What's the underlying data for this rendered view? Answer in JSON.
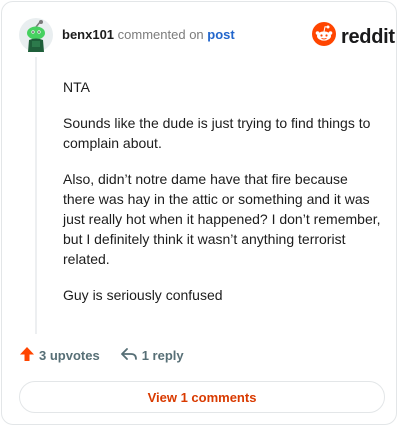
{
  "header": {
    "username": "benx101",
    "action_text": "commented on",
    "post_link": "post",
    "brand": "reddit",
    "avatar_icon": "snoo-avatar-icon",
    "brand_icon": "reddit-logo-icon"
  },
  "comment": {
    "paragraphs": [
      "NTA",
      "Sounds like the dude is just trying to find things to complain about.",
      "Also, didn’t notre dame have that fire because there was hay in the attic or something and it was just really hot when it happened? I don’t remember, but I definitely think it wasn’t anything terrorist related.",
      "Guy is seriously confused"
    ]
  },
  "actions": {
    "upvotes_label": "3 upvotes",
    "reply_label": "1 reply",
    "upvote_icon": "upvote-arrow-icon",
    "reply_icon": "reply-arrow-icon"
  },
  "footer": {
    "view_comments_label": "View 1 comments"
  },
  "colors": {
    "brand_orange": "#ff4500",
    "view_button_text": "#d93a00",
    "link_blue": "#2266cc"
  }
}
